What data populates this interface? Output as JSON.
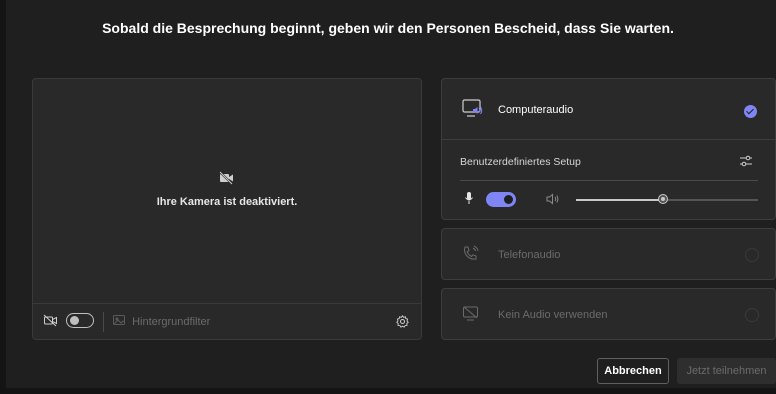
{
  "headline": "Sobald die Besprechung beginnt, geben wir den Personen Bescheid, dass Sie warten.",
  "camera": {
    "status_text": "Ihre Kamera ist deaktiviert.",
    "off_icon": "video-off-icon",
    "video_toggle_on": false,
    "background_filter_label": "Hintergrundfilter",
    "settings_icon": "gear-icon"
  },
  "audio": {
    "computer": {
      "label": "Computeraudio",
      "icon": "computer-speaker-icon",
      "selected": true,
      "setup_label": "Benutzerdefiniertes Setup",
      "mic_on": true,
      "volume_fraction": 0.48
    },
    "phone": {
      "label": "Telefonaudio",
      "icon": "phone-audio-icon",
      "selected": false
    },
    "none": {
      "label": "Kein Audio verwenden",
      "icon": "no-audio-icon",
      "selected": false
    }
  },
  "buttons": {
    "cancel": "Abbrechen",
    "join": "Jetzt teilnehmen"
  },
  "colors": {
    "accent": "#7f85f5",
    "background": "#1f1f1f",
    "panel": "#292929"
  }
}
